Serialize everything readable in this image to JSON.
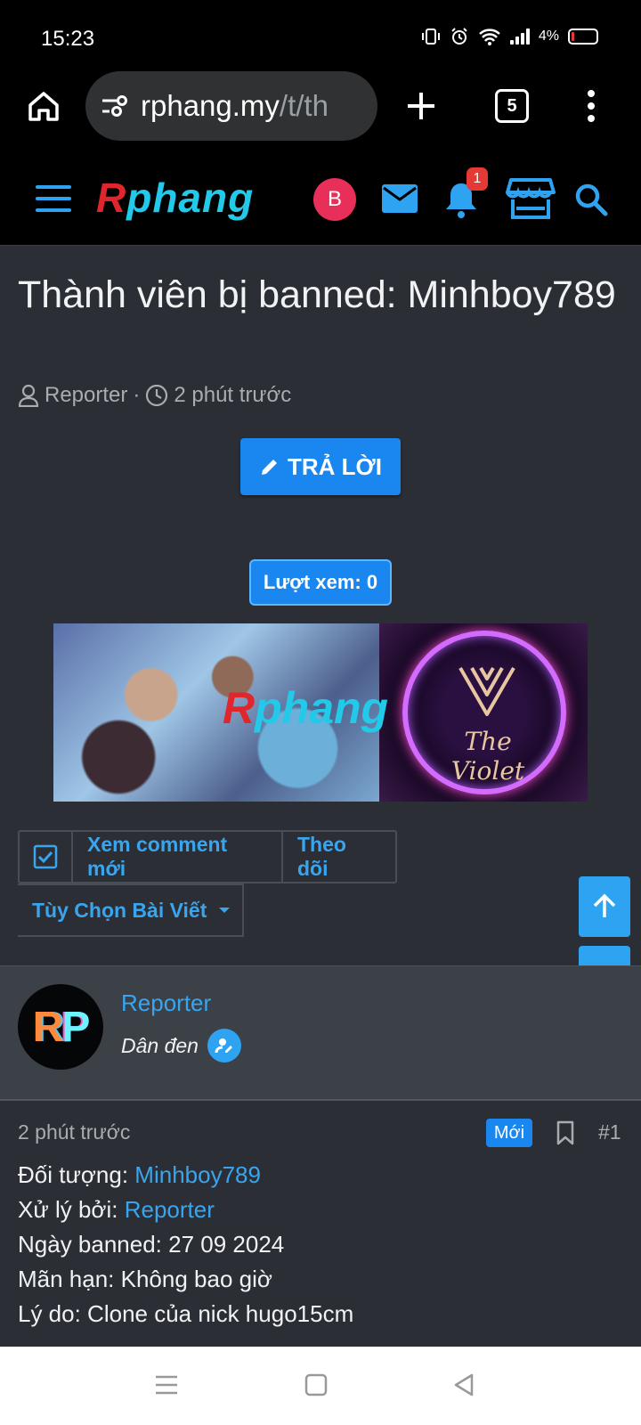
{
  "status": {
    "time": "15:23",
    "battery": "4%",
    "icons": [
      "vibrate-icon",
      "alarm-icon",
      "wifi-icon",
      "signal-icon",
      "battery-icon"
    ]
  },
  "browser": {
    "url_main": "rphang.my",
    "url_path": "/t/th",
    "tab_count": "5"
  },
  "header": {
    "logo_a": "R",
    "logo_b": "phang",
    "avatar_letter": "B",
    "notification_count": "1",
    "accent_color": "#2ea3f2"
  },
  "thread": {
    "title": "Thành viên bị banned: Minhboy789",
    "author": "Reporter",
    "separator": "·",
    "time": "2 phút trước",
    "reply_label": "TRẢ LỜI",
    "views_label": "Lượt xem: 0"
  },
  "banner": {
    "logo_a": "R",
    "logo_b": "phang",
    "brand": "The Violet"
  },
  "actions": {
    "new_comments": "Xem comment mới",
    "follow": "Theo dõi",
    "options": "Tùy Chọn Bài Viết"
  },
  "post": {
    "author": "Reporter",
    "role": "Dân đen",
    "avatar_r": "R",
    "avatar_p": "P",
    "time": "2 phút trước",
    "new_badge": "Mới",
    "number": "#1",
    "lines": [
      {
        "label": "Đối tượng: ",
        "value": "Minhboy789"
      },
      {
        "label": "Xử lý bởi: ",
        "value": "Reporter"
      },
      {
        "text": "Ngày banned: 27 09 2024"
      },
      {
        "text": "Mãn hạn: Không bao giờ"
      },
      {
        "text": "Lý do: Clone của nick hugo15cm"
      }
    ]
  }
}
